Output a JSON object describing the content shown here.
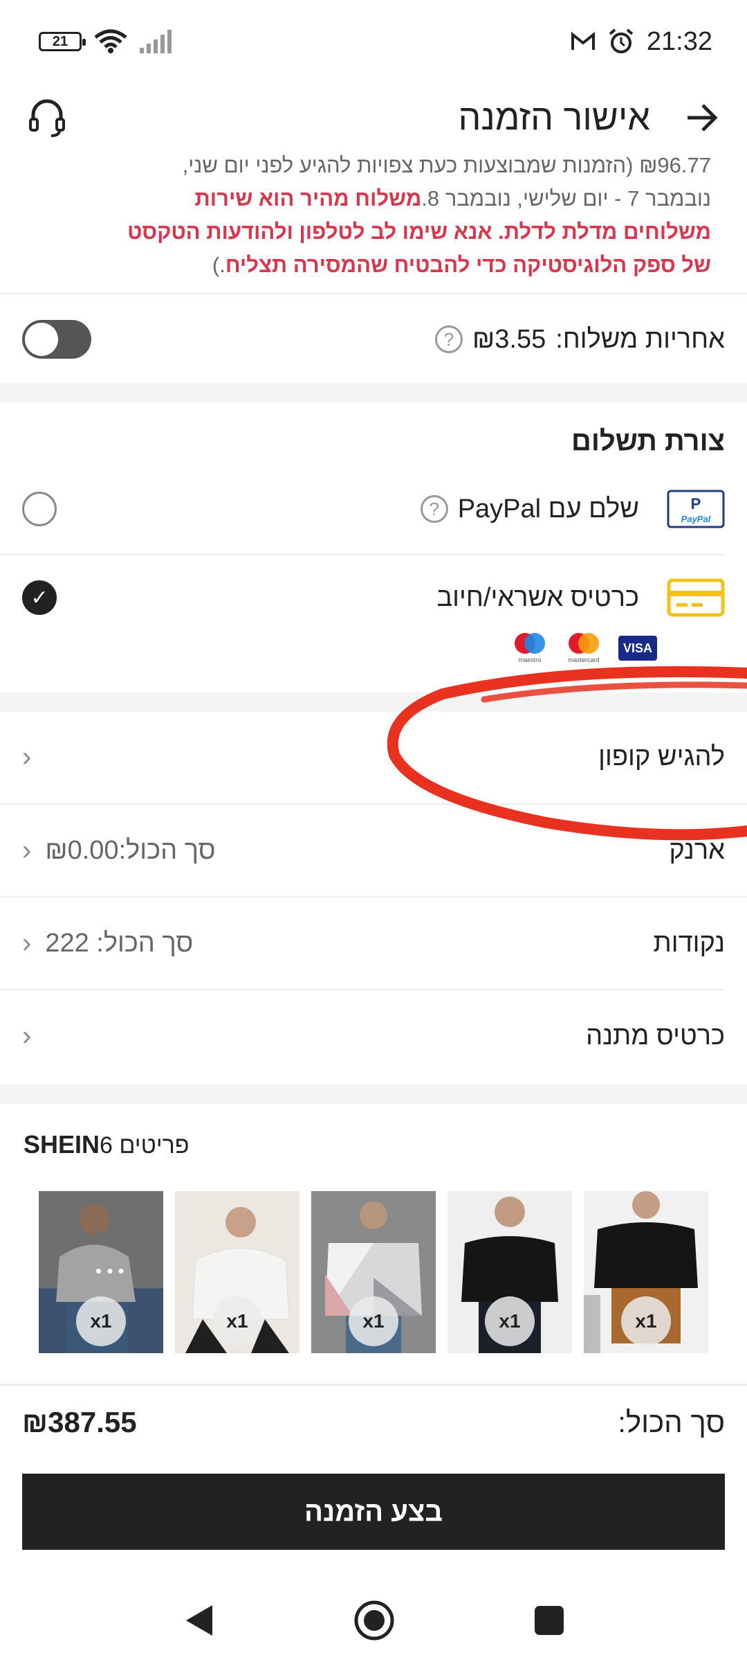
{
  "status_bar": {
    "battery": "21",
    "time": "21:32"
  },
  "header": {
    "title": "אישור הזמנה"
  },
  "notice": {
    "line1": "₪96.77 (הזמנות שמבוצעות כעת צפויות להגיע לפני יום שני,",
    "line2_plain": "נובמבר 7 - יום שלישי, נובמבר 8.",
    "line2_red": "משלוח מהיר הוא שירות",
    "line3_red": "משלוחים מדלת לדלת. אנא שימו לב לטלפון ולהודעות הטקסט",
    "line4_red": "של ספק הלוגיסטיקה כדי להבטיח שהמסירה תצליח",
    "line4_end": ".)"
  },
  "shipping_insurance": {
    "label": "אחריות משלוח:",
    "amount": "₪3.55"
  },
  "payment": {
    "title": "צורת תשלום",
    "paypal_label": "שלם עם PayPal",
    "paypal_logo": "PayPal",
    "card_label": "כרטיס אשראי/חיוב",
    "card_logos": [
      "VISA",
      "mastercard",
      "maestro"
    ]
  },
  "coupon": {
    "label": "להגיש קופון"
  },
  "wallet": {
    "label": "ארנק",
    "value": "סך הכול:₪0.00"
  },
  "points": {
    "label": "נקודות",
    "value": "סך הכול: 222"
  },
  "gift_card": {
    "label": "כרטיס מתנה"
  },
  "products": {
    "brand": "SHEIN",
    "count": "6",
    "count_suffix": " פריטים",
    "more": "• • •",
    "qtys": [
      "x1",
      "x1",
      "x1",
      "x1",
      "x1"
    ]
  },
  "footer": {
    "total_label": "סך הכול:",
    "total_amount": "₪387.55",
    "place_order": "בצע הזמנה"
  },
  "colors": {
    "accent_red": "#d9364c",
    "annotation_red": "#e8321f",
    "dark": "#222222"
  }
}
